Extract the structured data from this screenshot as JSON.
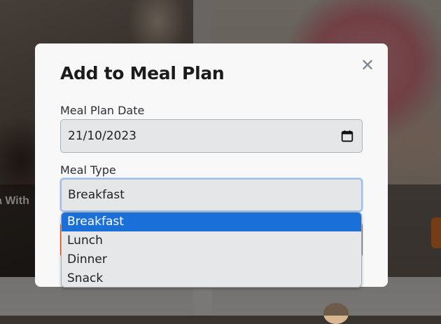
{
  "background": {
    "card_title_partial": "a With"
  },
  "modal": {
    "title": "Add to Meal Plan",
    "close_glyph": "✕",
    "date_field": {
      "label": "Meal Plan Date",
      "value": "21/10/2023",
      "icon": "calendar-icon"
    },
    "meal_type_field": {
      "label": "Meal Type",
      "selected": "Breakfast",
      "options": [
        "Breakfast",
        "Lunch",
        "Dinner",
        "Snack"
      ]
    }
  },
  "colors": {
    "selected_option": "#1b6fd8",
    "focus_ring": "#9fbde6",
    "accent_button": "#c8622a"
  }
}
